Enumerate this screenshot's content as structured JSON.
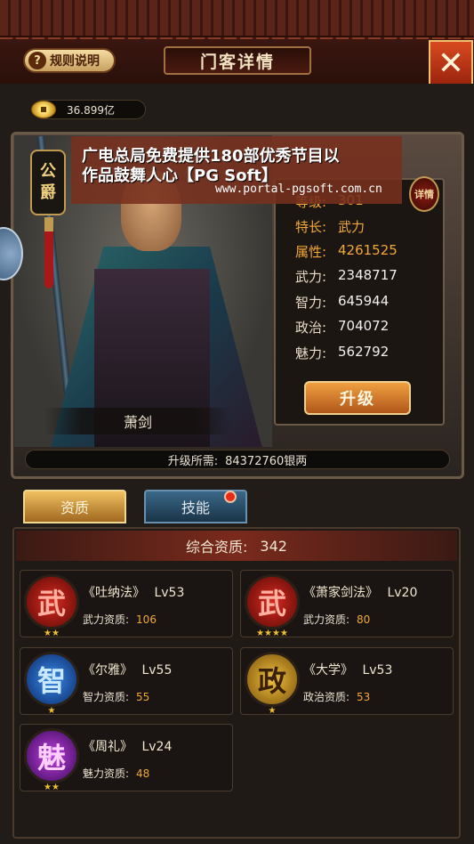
{
  "header": {
    "rules_label": "规则说明",
    "title": "门客详情",
    "close_glyph": "✕"
  },
  "currency": {
    "value": "36.899亿"
  },
  "hero": {
    "rank_chars": [
      "公",
      "爵"
    ],
    "name": "萧剑",
    "upgrade_cost_label": "升级所需:",
    "upgrade_cost_value": "84372760银两",
    "detail_label": "详情",
    "upgrade_button": "升级"
  },
  "stats": [
    {
      "key": "等级:",
      "value": "301"
    },
    {
      "key": "特长:",
      "value": "武力"
    },
    {
      "key": "属性:",
      "value": "4261525"
    },
    {
      "key": "武力:",
      "value": "2348717"
    },
    {
      "key": "智力:",
      "value": "645944"
    },
    {
      "key": "政治:",
      "value": "704072"
    },
    {
      "key": "魅力:",
      "value": "562792"
    }
  ],
  "watermark": {
    "line1": "广电总局免费提供180部优秀节目以",
    "line2": "作品鼓舞人心【PG Soft】",
    "url": "www.portal-pgsoft.com.cn"
  },
  "tabs": {
    "aptitude": "资质",
    "skills": "技能"
  },
  "aptitude": {
    "label": "综合资质:",
    "value": "342",
    "skills": [
      {
        "icon": "武",
        "color": "red",
        "stars": "★★",
        "name": "《吐纳法》",
        "level": "Lv53",
        "attr": "武力资质:",
        "value": "106"
      },
      {
        "icon": "武",
        "color": "red",
        "stars": "★★★★",
        "name": "《萧家剑法》",
        "level": "Lv20",
        "attr": "武力资质:",
        "value": "80"
      },
      {
        "icon": "智",
        "color": "blue",
        "stars": "★",
        "name": "《尔雅》",
        "level": "Lv55",
        "attr": "智力资质:",
        "value": "55"
      },
      {
        "icon": "政",
        "color": "gold",
        "stars": "★",
        "name": "《大学》",
        "level": "Lv53",
        "attr": "政治资质:",
        "value": "53"
      },
      {
        "icon": "魅",
        "color": "purple",
        "stars": "★★",
        "name": "《周礼》",
        "level": "Lv24",
        "attr": "魅力资质:",
        "value": "48"
      }
    ]
  }
}
